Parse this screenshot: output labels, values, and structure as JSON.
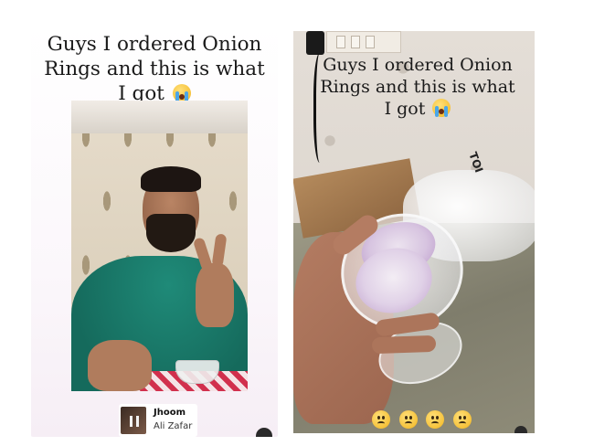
{
  "left_story": {
    "caption_line1": "Guys I ordered Onion",
    "caption_line2": "Rings and this is what",
    "caption_line3": "I got",
    "caption_emoji": "loudly-crying-face",
    "music": {
      "song_title": "Jhoom",
      "artist": "Ali Zafar",
      "icon": "pause-icon"
    }
  },
  "right_story": {
    "caption_line1": "Guys I ordered Onion",
    "caption_line2": "Rings and this is what",
    "caption_line3": "I got",
    "caption_emoji": "loudly-crying-face",
    "bag_text": "TOI",
    "reaction_emojis": [
      "pleading-face",
      "pleading-face",
      "pleading-face",
      "pleading-face"
    ]
  },
  "colors": {
    "caption_text": "#1a1a1a",
    "shirt": "#1f8a78",
    "tablecloth": "#d1304d",
    "onion": "#d7c4e0"
  }
}
